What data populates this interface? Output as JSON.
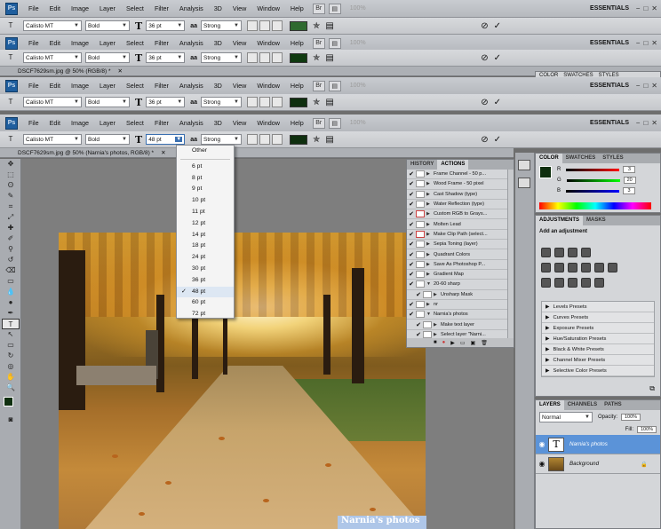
{
  "app": {
    "logo": "Ps",
    "menus": [
      "File",
      "Edit",
      "Image",
      "Layer",
      "Select",
      "Filter",
      "Analysis",
      "3D",
      "View",
      "Window",
      "Help"
    ],
    "zoom": "100%",
    "workspace": "ESSENTIALS"
  },
  "options": {
    "font_family": "Calisto MT",
    "font_style": "Bold",
    "aa_label": "aa",
    "aa_mode": "Strong",
    "size_rows": [
      "36 pt",
      "36 pt",
      "36 pt",
      "36 pt",
      "48 pt"
    ],
    "color_rows": [
      "#2f6a2f",
      "#103a10",
      "#0f2f0f",
      "#0f2f0f",
      "#0f2f0f"
    ]
  },
  "documents": {
    "tab1": "DSCF7629sm.jpg @ 50% (RGB/8) *",
    "tab2": "DSCF7629sm.jpg @ 50% (Narnia's photos, RGB/8) *"
  },
  "font_size_menu": {
    "header": "Other",
    "items": [
      "6 pt",
      "8 pt",
      "9 pt",
      "10 pt",
      "11 pt",
      "12 pt",
      "14 pt",
      "18 pt",
      "24 pt",
      "30 pt",
      "36 pt",
      "48 pt",
      "60 pt",
      "72 pt"
    ],
    "selected": "48 pt"
  },
  "actions_panel": {
    "tabs": [
      "HISTORY",
      "ACTIONS"
    ],
    "rows": [
      "Frame Channel - 50 p...",
      "Wood Frame - 50 pixel",
      "Cast Shadow (type)",
      "Water Reflection (type)",
      "Custom RGB to Grays...",
      "Molten Lead",
      "Make Clip Path (select...",
      "Sepia Toning (layer)",
      "Quadrant Colors",
      "Save As Photoshop P...",
      "Gradient Map",
      "20-60 sharp",
      "Unsharp Mask",
      "nr",
      "Narnia's photos",
      "Make text layer",
      "Select layer \"Narni..."
    ]
  },
  "color_panel": {
    "tabs": [
      "COLOR",
      "SWATCHES",
      "STYLES"
    ],
    "r_label": "R",
    "g_label": "G",
    "b_label": "B",
    "r": "3",
    "g": "20",
    "b": "3"
  },
  "adjustments_panel": {
    "tabs": [
      "ADJUSTMENTS",
      "MASKS"
    ],
    "title": "Add an adjustment",
    "presets": [
      "Levels Presets",
      "Curves Presets",
      "Exposure Presets",
      "Hue/Saturation Presets",
      "Black & White Presets",
      "Channel Mixer Presets",
      "Selective Color Presets"
    ]
  },
  "layers_panel": {
    "tabs": [
      "LAYERS",
      "CHANNELS",
      "PATHS"
    ],
    "blend_mode": "Normal",
    "opacity_label": "Opacity:",
    "opacity": "100%",
    "fill_label": "Fill:",
    "fill": "100%",
    "layers": [
      {
        "name": "Narnia's photos",
        "thumb": "T"
      },
      {
        "name": "Background"
      }
    ]
  },
  "canvas": {
    "type_text": "Narnia's photos"
  }
}
